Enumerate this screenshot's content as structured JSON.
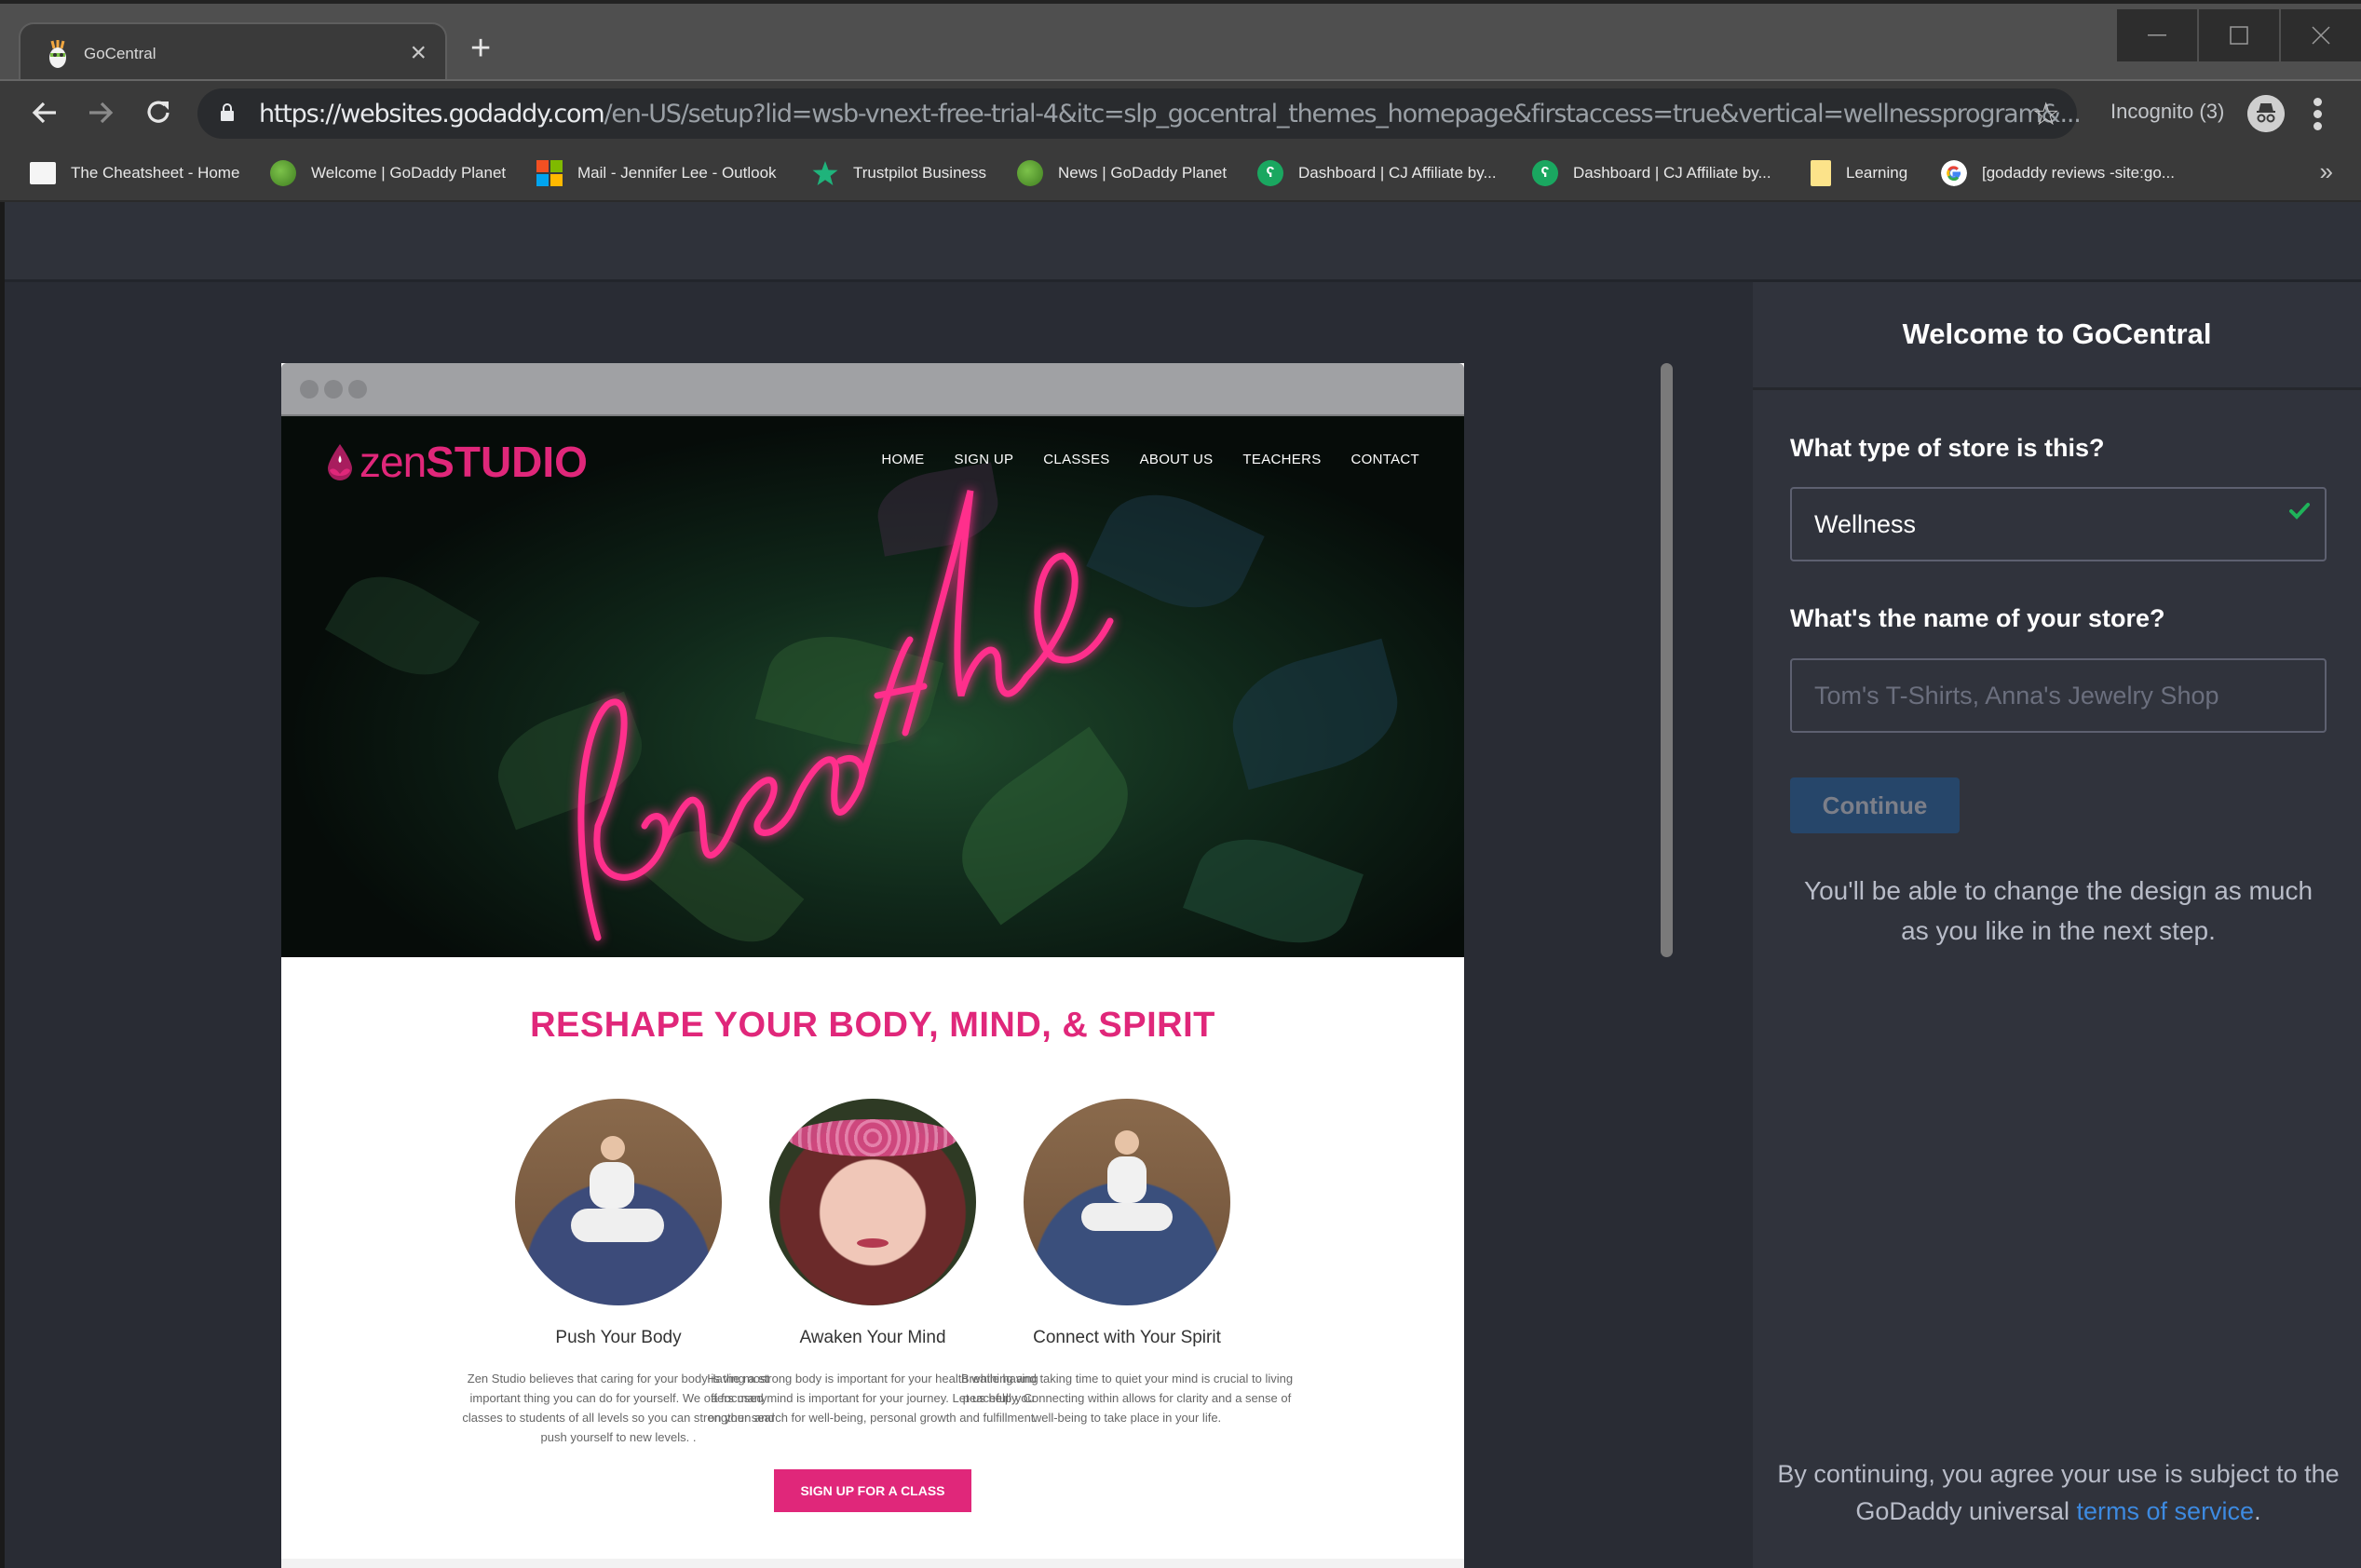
{
  "browser": {
    "tab": {
      "title": "GoCentral",
      "favicon": "godaddy-guy-icon"
    },
    "address": {
      "scheme": "https://",
      "host": "websites.godaddy.com",
      "path": "/en-US/setup?lid=wsb-vnext-free-trial-4&itc=slp_gocentral_themes_homepage&firstaccess=true&vertical=wellnessprogram&..."
    },
    "incognito_label": "Incognito (3)",
    "bookmarks": [
      {
        "label": "The Cheatsheet - Home",
        "icon": "cheatsheet-icon"
      },
      {
        "label": "Welcome | GoDaddy Planet",
        "icon": "globe-icon"
      },
      {
        "label": "Mail - Jennifer Lee - Outlook",
        "icon": "microsoft-icon"
      },
      {
        "label": "Trustpilot Business",
        "icon": "trustpilot-star-icon"
      },
      {
        "label": "News | GoDaddy Planet",
        "icon": "globe-icon"
      },
      {
        "label": "Dashboard | CJ Affiliate by...",
        "icon": "cj-affiliate-icon"
      },
      {
        "label": "Dashboard | CJ Affiliate by...",
        "icon": "cj-affiliate-icon"
      },
      {
        "label": "Learning",
        "icon": "folder-icon"
      },
      {
        "label": "[godaddy reviews -site:go...",
        "icon": "google-icon"
      }
    ],
    "bookmarks_overflow": "»"
  },
  "preview": {
    "logo": {
      "light": "zen",
      "bold": "STUDIO"
    },
    "nav": [
      "HOME",
      "SIGN UP",
      "CLASSES",
      "ABOUT US",
      "TEACHERS",
      "CONTACT"
    ],
    "hero_text": "breathe",
    "section_title": "RESHAPE YOUR BODY, MIND, & SPIRIT",
    "features": [
      {
        "title": "Push Your Body",
        "text": "Zen Studio believes that caring for your body is the most important thing you can do for yourself. We offers many classes to students of all levels so you can strengthen and push yourself to new levels. ."
      },
      {
        "title": "Awaken Your Mind",
        "text": "Having a strong body is important for your health while having a focused mind is important for your journey. Let us help you on your search for well-being, personal growth and fulfillment."
      },
      {
        "title": "Connect with Your Spirit",
        "text": "Breathing and taking time to quiet your mind is crucial to living peacefully. Connecting within allows for clarity and a sense of well-being to take place in your life."
      }
    ],
    "cta": "SIGN UP FOR A CLASS"
  },
  "panel": {
    "title": "Welcome to GoCentral",
    "store_type_label": "What type of store is this?",
    "store_type_value": "Wellness",
    "store_name_label": "What's the name of your store?",
    "store_name_placeholder": "Tom's T-Shirts, Anna's Jewelry Shop",
    "continue_label": "Continue",
    "note": "You'll be able to change the design as much as you like in the next step.",
    "legal_prefix": "By continuing, you agree your use is subject to the GoDaddy universal ",
    "legal_link": "terms of service",
    "legal_suffix": "."
  },
  "colors": {
    "brand_pink": "#e0277a",
    "panel_bg": "#30333c",
    "continue_disabled": "#26466a",
    "link_blue": "#3d8ae0",
    "valid_green": "#1fb35a"
  }
}
